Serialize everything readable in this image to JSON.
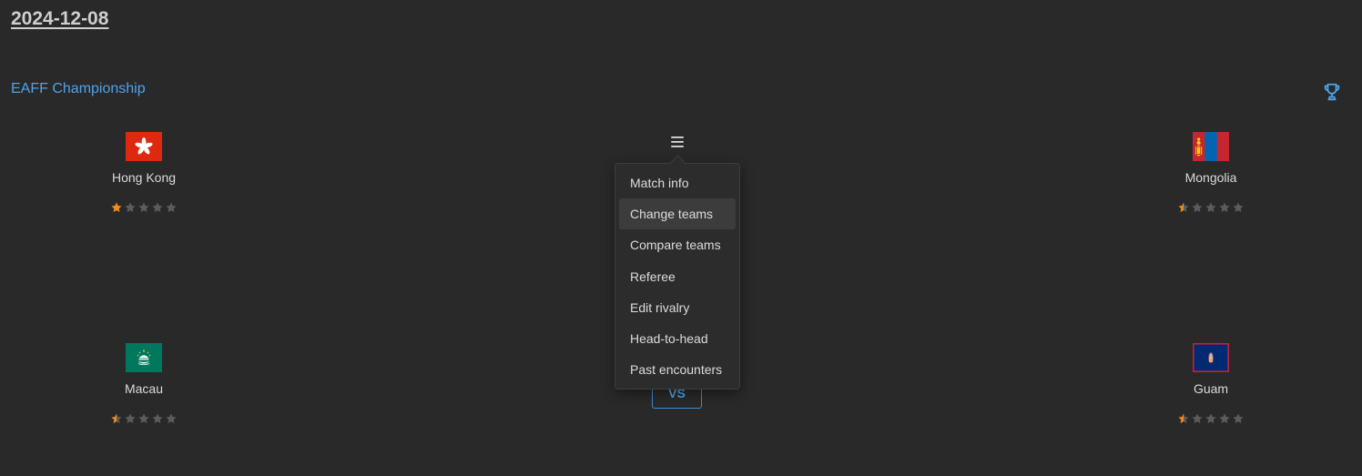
{
  "date": "2024-12-08",
  "competition": "EAFF Championship",
  "icons": {
    "trophy": "trophy-icon",
    "menu": "hamburger-menu-icon",
    "star": "star-icon"
  },
  "colors": {
    "accent": "#4ea3e8",
    "star_filled": "#f08c1a",
    "star_empty": "#5c5c5c",
    "background": "#292929"
  },
  "matches": [
    {
      "home": {
        "name": "Hong Kong",
        "flag": "hong-kong-flag",
        "rating": 1
      },
      "away": {
        "name": "Mongolia",
        "flag": "mongolia-flag",
        "rating": 0.5
      }
    },
    {
      "home": {
        "name": "Macau",
        "flag": "macau-flag",
        "rating": 0.5
      },
      "away": {
        "name": "Guam",
        "flag": "guam-flag",
        "rating": 0.5
      }
    }
  ],
  "vs_label": "VS",
  "context_menu": {
    "items": [
      "Match info",
      "Change teams",
      "Compare teams",
      "Referee",
      "Edit rivalry",
      "Head-to-head",
      "Past encounters"
    ],
    "active_index": 1
  }
}
